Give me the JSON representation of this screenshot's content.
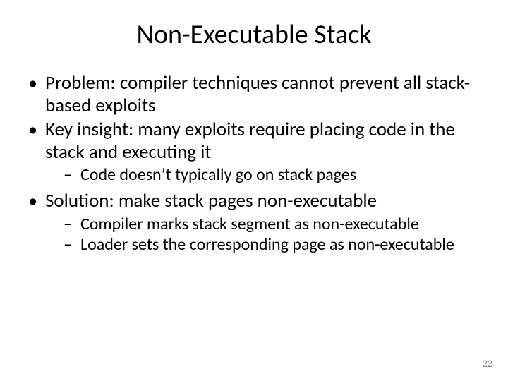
{
  "title": "Non-Executable Stack",
  "bullets": {
    "b1": "Problem: compiler techniques cannot prevent all stack-based exploits",
    "b2": "Key insight: many exploits require placing code in the stack and executing it",
    "b2_1": "Code doesn’t typically go on stack pages",
    "b3": "Solution: make stack pages non-executable",
    "b3_1": "Compiler marks stack segment as non-executable",
    "b3_2": "Loader sets the corresponding page as non-executable"
  },
  "page_number": "22"
}
